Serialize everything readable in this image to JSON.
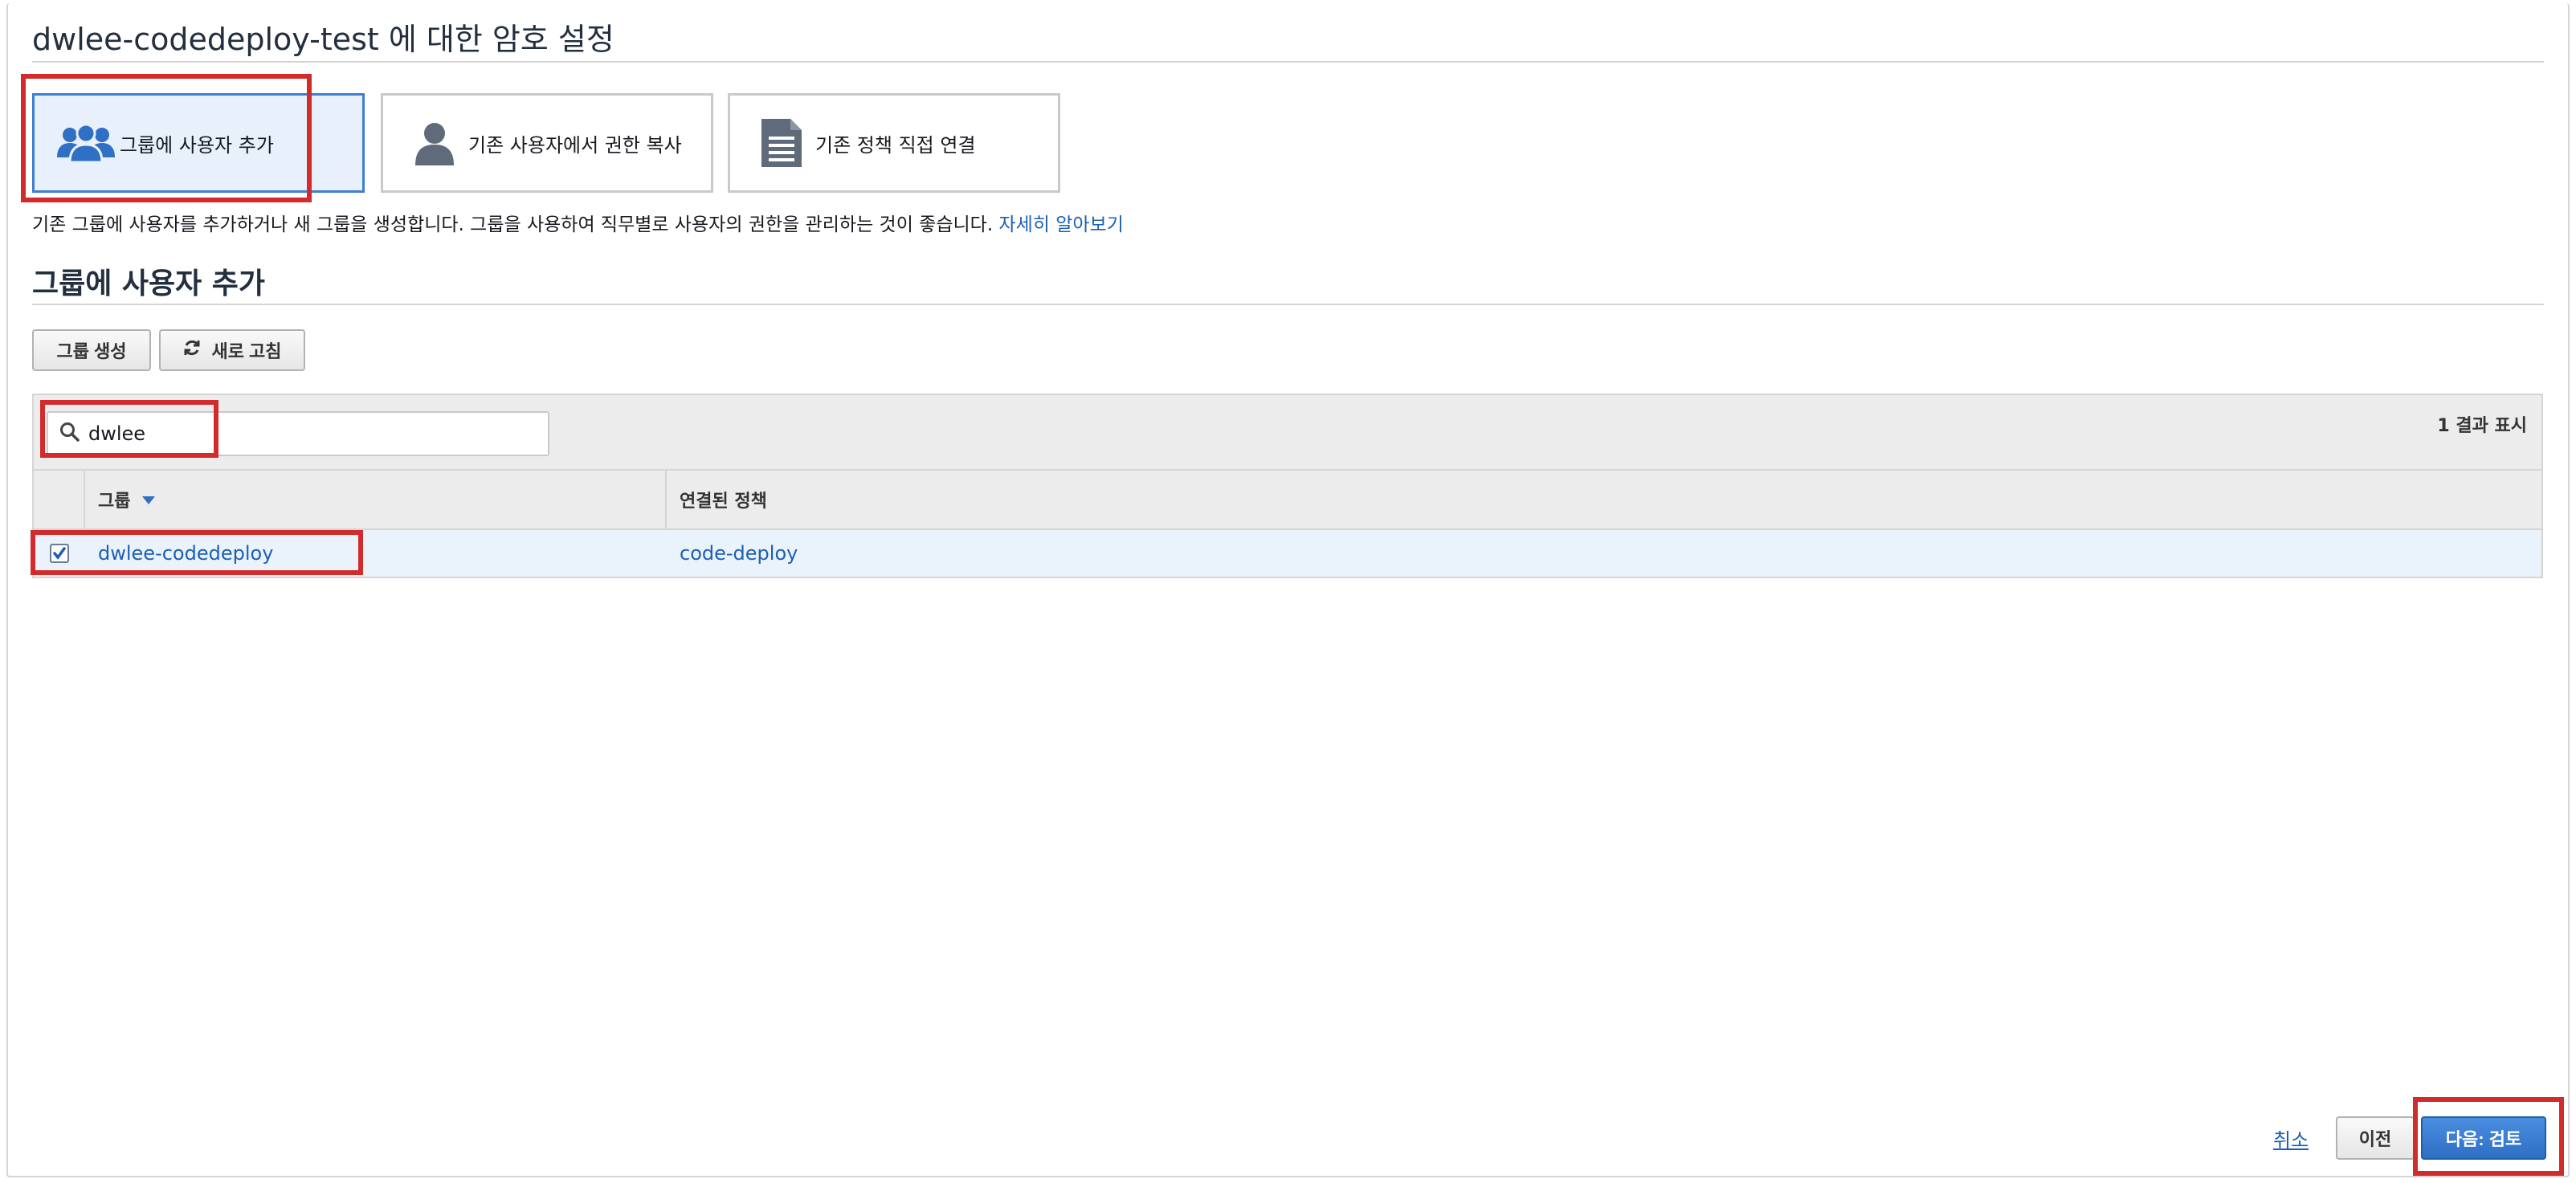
{
  "page": {
    "title": "dwlee-codedeploy-test 에 대한 암호 설정"
  },
  "options": [
    {
      "label": "그룹에 사용자 추가",
      "icon": "users-group-icon",
      "selected": true
    },
    {
      "label": "기존 사용자에서 권한 복사",
      "icon": "user-icon",
      "selected": false
    },
    {
      "label": "기존 정책 직접 연결",
      "icon": "document-icon",
      "selected": false
    }
  ],
  "description": {
    "text": "기존 그룹에 사용자를 추가하거나 새 그룹을 생성합니다. 그룹을 사용하여 직무별로 사용자의 권한을 관리하는 것이 좋습니다.",
    "link": "자세히 알아보기"
  },
  "section": {
    "title": "그룹에 사용자 추가"
  },
  "toolbar": {
    "create_group": "그룹 생성",
    "refresh": "새로 고침",
    "refresh_icon": "refresh-icon"
  },
  "table": {
    "search_value": "dwlee",
    "search_icon": "search-icon",
    "result_count": "1 결과 표시",
    "columns": [
      "그룹",
      "연결된 정책"
    ],
    "sort_icon": "sort-desc-icon",
    "rows": [
      {
        "checked": true,
        "group": "dwlee-codedeploy",
        "policy": "code-deploy"
      }
    ]
  },
  "footer": {
    "cancel": "취소",
    "previous": "이전",
    "next": "다음: 검토"
  },
  "colors": {
    "accent": "#1b5fb5",
    "highlight": "#d22b2b",
    "primary_button": "#2f6fc4",
    "selected_card": "#e8f0fb"
  }
}
